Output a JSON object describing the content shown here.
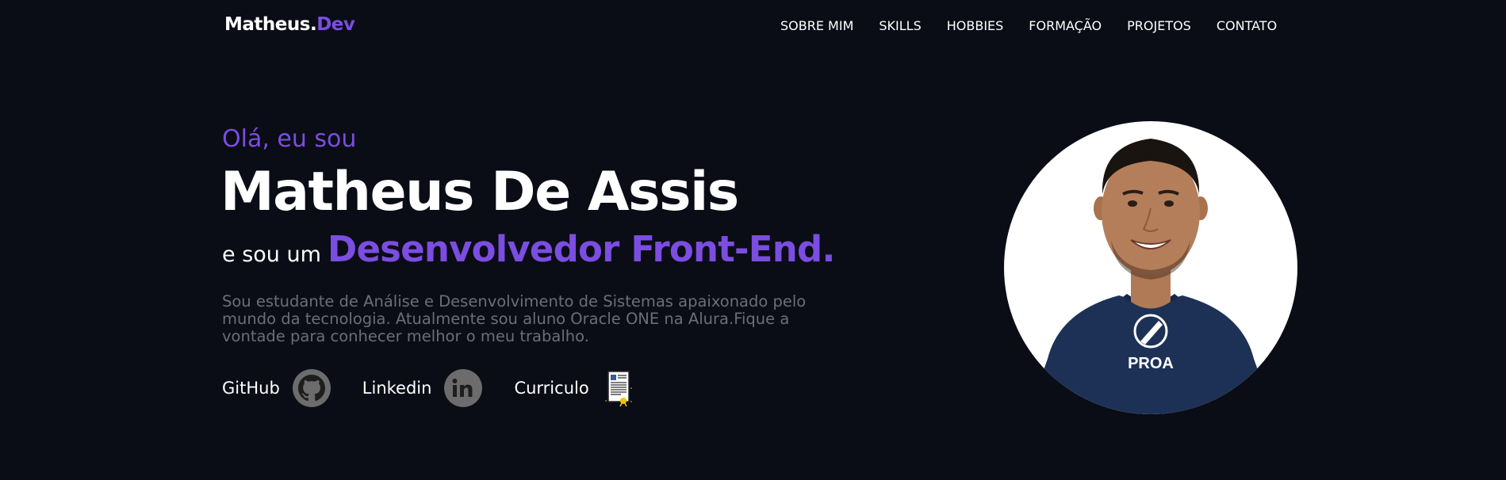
{
  "header": {
    "logo_main": "Matheus.",
    "logo_accent": "Dev",
    "nav": [
      "SOBRE MIM",
      "SKILLS",
      "HOBBIES",
      "FORMAÇÃO",
      "PROJETOS",
      "CONTATO"
    ]
  },
  "hero": {
    "greeting": "Olá, eu sou",
    "name": "Matheus De Assis",
    "role_prefix": "e sou um",
    "role": "Desenvolvedor Front-End.",
    "description": "Sou estudante de Análise e Desenvolvimento de Sistemas apaixonado pelo mundo da tecnologia. Atualmente sou aluno Oracle ONE na Alura.Fique a vontade para conhecer melhor o meu trabalho.",
    "links": {
      "github": "GitHub",
      "linkedin": "Linkedin",
      "curriculo": "Curriculo"
    }
  },
  "portrait": {
    "shirt_text": "PROA"
  },
  "colors": {
    "background": "#0a0d16",
    "accent": "#7b4de0",
    "muted_text": "#6b6e78"
  },
  "icons": [
    "github-icon",
    "linkedin-icon",
    "document-icon"
  ]
}
